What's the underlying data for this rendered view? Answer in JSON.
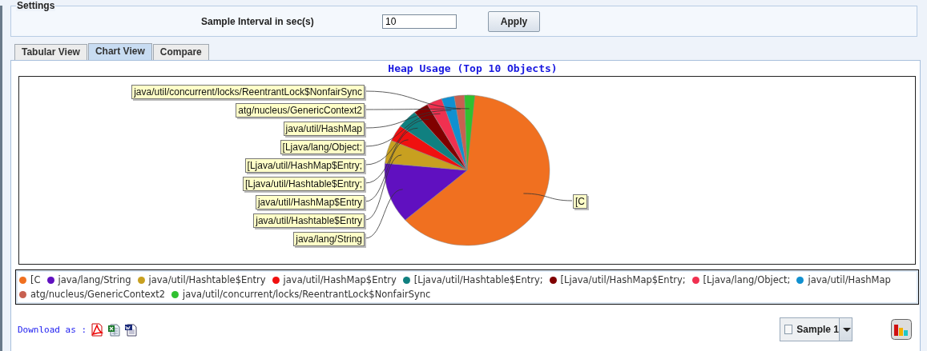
{
  "settings": {
    "title": "Settings",
    "interval_label": "Sample Interval in sec(s)",
    "interval_value": "10",
    "apply_button": "Apply"
  },
  "tabs": [
    {
      "label": "Tabular View",
      "selected": false
    },
    {
      "label": "Chart View",
      "selected": true
    },
    {
      "label": "Compare",
      "selected": false
    }
  ],
  "chart": {
    "title": "Heap Usage (Top 10 Objects)",
    "callouts": [
      "java/util/concurrent/locks/ReentrantLock$NonfairSync",
      "atg/nucleus/GenericContext2",
      "java/util/HashMap",
      "[Ljava/lang/Object;",
      "[Ljava/util/HashMap$Entry;",
      "[Ljava/util/Hashtable$Entry;",
      "java/util/HashMap$Entry",
      "[C",
      "java/util/Hashtable$Entry",
      "java/lang/String"
    ],
    "legend": [
      {
        "label": "[C",
        "color": "#f07020"
      },
      {
        "label": "java/lang/String",
        "color": "#6010c0"
      },
      {
        "label": "java/util/Hashtable$Entry",
        "color": "#c8a020"
      },
      {
        "label": "java/util/HashMap$Entry",
        "color": "#f01010"
      },
      {
        "label": "[Ljava/util/Hashtable$Entry;",
        "color": "#108080"
      },
      {
        "label": "[Ljava/util/HashMap$Entry;",
        "color": "#800000"
      },
      {
        "label": "[Ljava/lang/Object;",
        "color": "#f03050"
      },
      {
        "label": "java/util/HashMap",
        "color": "#1090d0"
      },
      {
        "label": "atg/nucleus/GenericContext2",
        "color": "#c86050"
      },
      {
        "label": "java/util/concurrent/locks/ReentrantLock$NonfairSync",
        "color": "#30c030"
      }
    ]
  },
  "download": {
    "label": "Download as :"
  },
  "sample_selector": {
    "label": "Sample 1",
    "checked": false
  }
}
